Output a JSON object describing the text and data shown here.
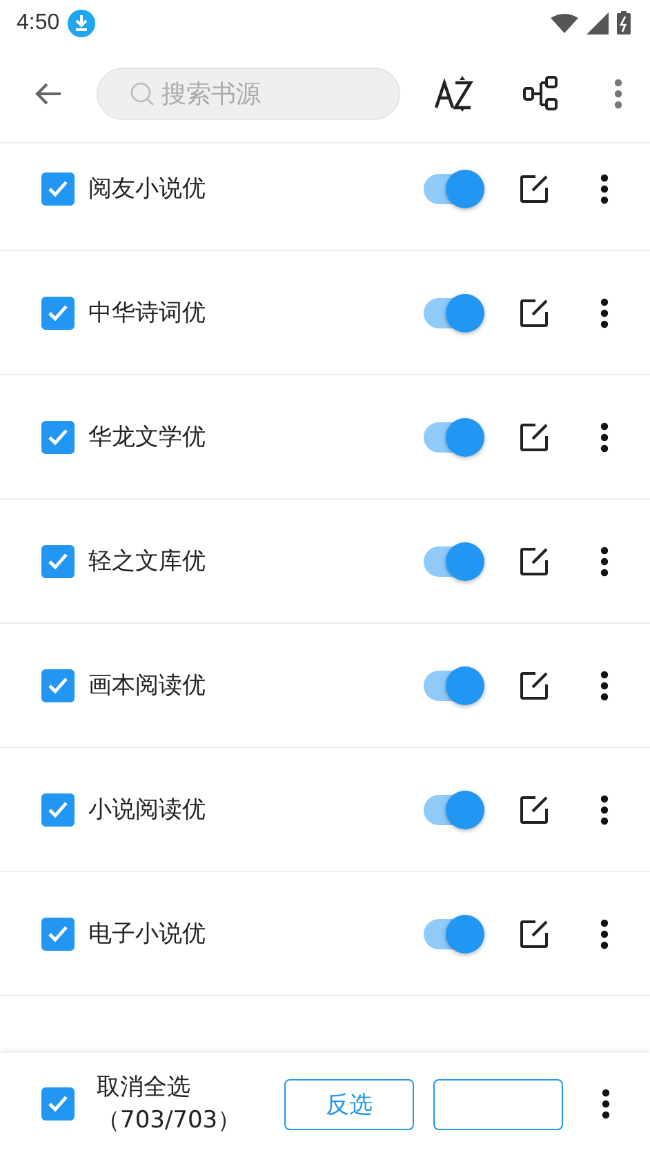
{
  "status_bar": {
    "time": "4:50"
  },
  "toolbar": {
    "search": {
      "placeholder": "搜索书源"
    }
  },
  "sources": [
    {
      "name": "阅友小说优",
      "checked": true,
      "on": true
    },
    {
      "name": "中华诗词优",
      "checked": true,
      "on": true
    },
    {
      "name": "华龙文学优",
      "checked": true,
      "on": true
    },
    {
      "name": "轻之文库优",
      "checked": true,
      "on": true
    },
    {
      "name": "画本阅读优",
      "checked": true,
      "on": true
    },
    {
      "name": "小说阅读优",
      "checked": true,
      "on": true
    },
    {
      "name": "电子小说优",
      "checked": true,
      "on": true
    }
  ],
  "bottom_bar": {
    "select_all": {
      "label": "取消全选",
      "count": "（703/703）",
      "checked": true
    },
    "invert_button": "反选"
  }
}
